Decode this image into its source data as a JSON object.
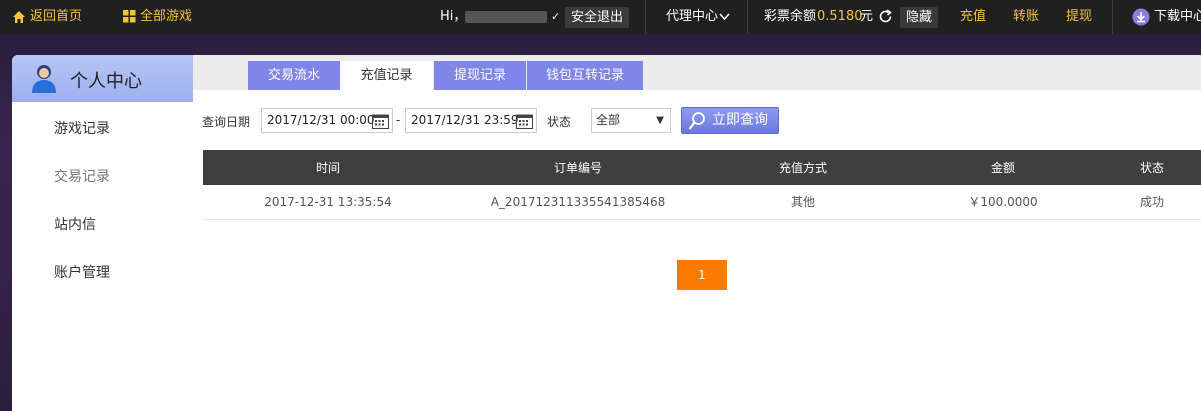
{
  "topbar": {
    "home": "返回首页",
    "all_games": "全部游戏",
    "greeting": "Hi，",
    "logout": "安全退出",
    "agent_center": "代理中心",
    "balance_label": "彩票余额",
    "balance_value": "0.5180",
    "balance_unit": "元",
    "hide": "隐藏",
    "recharge": "充值",
    "transfer": "转账",
    "withdraw": "提现",
    "download": "下载中心"
  },
  "sidebar": {
    "title": "个人中心",
    "items": [
      {
        "label": "游戏记录"
      },
      {
        "label": "交易记录"
      },
      {
        "label": "站内信"
      },
      {
        "label": "账户管理"
      }
    ]
  },
  "tabs": [
    {
      "label": "交易流水"
    },
    {
      "label": "充值记录"
    },
    {
      "label": "提现记录"
    },
    {
      "label": "钱包互转记录"
    }
  ],
  "filter": {
    "date_label": "查询日期",
    "start": "2017/12/31 00:00",
    "dash": "-",
    "end": "2017/12/31 23:59",
    "status_label": "状态",
    "status_value": "全部",
    "query_button": "立即查询"
  },
  "table": {
    "headers": [
      "时间",
      "订单编号",
      "充值方式",
      "金额",
      "状态"
    ],
    "rows": [
      [
        "2017-12-31 13:35:54",
        "A_20171231133554138546​8",
        "其他",
        "￥100.0000",
        "成功"
      ]
    ]
  },
  "pagination": {
    "current": "1"
  },
  "colors": {
    "accent": "#7f86e8",
    "topbar": "#202020",
    "highlight": "#f3c53a",
    "page": "#ff7a00"
  }
}
